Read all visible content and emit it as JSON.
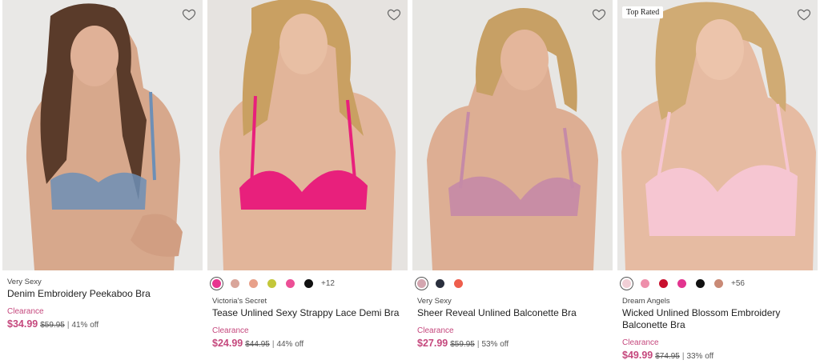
{
  "products": [
    {
      "brand": "Very Sexy",
      "name": "Denim Embroidery Peekaboo Bra",
      "tag": "Clearance",
      "price": "$34.99",
      "was": "$59.95",
      "discount": "41% off",
      "swatches": [],
      "more_colors": "",
      "badge": ""
    },
    {
      "brand": "Victoria's Secret",
      "name": "Tease Unlined Sexy Strappy Lace Demi Bra",
      "tag": "Clearance",
      "price": "$24.99",
      "was": "$44.95",
      "discount": "44% off",
      "swatches": [
        "#e7348f",
        "#d9a59a",
        "#e8a08a",
        "#c3c73a",
        "#ec4f96",
        "#111111"
      ],
      "more_colors": "+12",
      "badge": ""
    },
    {
      "brand": "Very Sexy",
      "name": "Sheer Reveal Unlined Balconette Bra",
      "tag": "Clearance",
      "price": "$27.99",
      "was": "$59.95",
      "discount": "53% off",
      "swatches": [
        "#d4a6b0",
        "#2a2f3d",
        "#ee5e4d"
      ],
      "more_colors": "",
      "badge": ""
    },
    {
      "brand": "Dream Angels",
      "name": "Wicked Unlined Blossom Embroidery Balconette Bra",
      "tag": "Clearance",
      "price": "$49.99",
      "was": "$74.95",
      "discount": "33% off",
      "swatches": [
        "#f1cfd6",
        "#ee8fab",
        "#c8102e",
        "#e2348f",
        "#111111",
        "#c98a76"
      ],
      "more_colors": "+56",
      "badge": "Top Rated"
    }
  ],
  "colors": {
    "sale_pink": "#c5487d",
    "bra_blue": "#6d8fb6",
    "bra_pink": "#e8207c",
    "bra_mauve": "#c58aa7",
    "bra_blush": "#f6c6d2"
  },
  "icons": {
    "wishlist": "heart-outline-icon"
  }
}
